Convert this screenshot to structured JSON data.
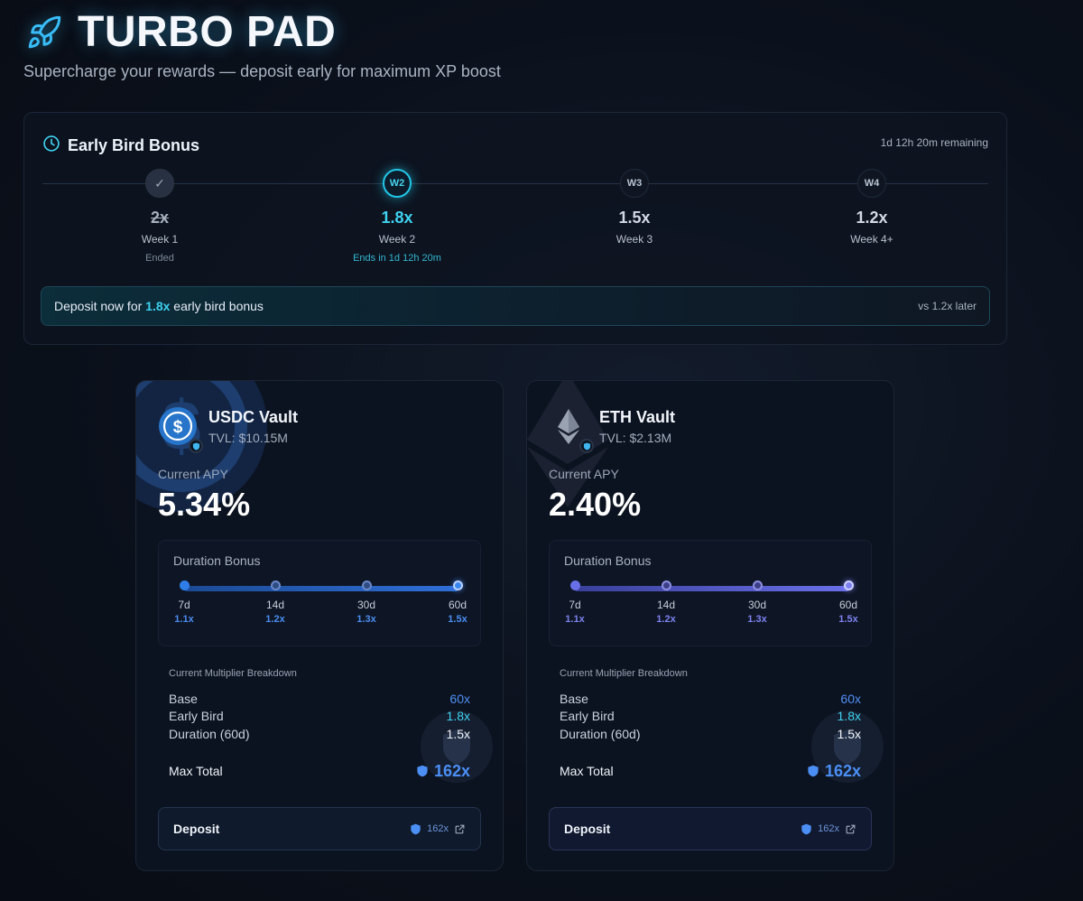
{
  "header": {
    "title": "TURBO PAD",
    "subtitle": "Supercharge your rewards — deposit early for maximum XP boost"
  },
  "early_bird": {
    "title": "Early Bird Bonus",
    "remaining": "1d 12h 20m remaining",
    "weeks": [
      {
        "node": "✓",
        "multiplier": "2x",
        "label": "Week 1",
        "note": "Ended",
        "state": "done"
      },
      {
        "node": "W2",
        "multiplier": "1.8x",
        "label": "Week 2",
        "note": "Ends in 1d 12h 20m",
        "state": "active"
      },
      {
        "node": "W3",
        "multiplier": "1.5x",
        "label": "Week 3",
        "note": "",
        "state": "future"
      },
      {
        "node": "W4",
        "multiplier": "1.2x",
        "label": "Week 4+",
        "note": "",
        "state": "future"
      }
    ],
    "banner": {
      "prefix": "Deposit now for ",
      "highlight": "1.8x",
      "suffix": " early bird bonus",
      "compare": "vs 1.2x later"
    }
  },
  "vaults": [
    {
      "name": "USDC Vault",
      "tvl": "TVL: $10.15M",
      "apy_label": "Current APY",
      "apy": "5.34%",
      "duration_title": "Duration Bonus",
      "durations": [
        {
          "day": "7d",
          "mult": "1.1x"
        },
        {
          "day": "14d",
          "mult": "1.2x"
        },
        {
          "day": "30d",
          "mult": "1.3x"
        },
        {
          "day": "60d",
          "mult": "1.5x"
        }
      ],
      "breakdown_title": "Current Multiplier Breakdown",
      "breakdown": [
        {
          "label": "Base",
          "value": "60x"
        },
        {
          "label": "Early Bird",
          "value": "1.8x"
        },
        {
          "label": "Duration (60d)",
          "value": "1.5x"
        }
      ],
      "max_label": "Max Total",
      "max_value": "162x",
      "deposit_label": "Deposit",
      "deposit_mult": "162x",
      "accent": "#2f7ee8"
    },
    {
      "name": "ETH Vault",
      "tvl": "TVL: $2.13M",
      "apy_label": "Current APY",
      "apy": "2.40%",
      "duration_title": "Duration Bonus",
      "durations": [
        {
          "day": "7d",
          "mult": "1.1x"
        },
        {
          "day": "14d",
          "mult": "1.2x"
        },
        {
          "day": "30d",
          "mult": "1.3x"
        },
        {
          "day": "60d",
          "mult": "1.5x"
        }
      ],
      "breakdown_title": "Current Multiplier Breakdown",
      "breakdown": [
        {
          "label": "Base",
          "value": "60x"
        },
        {
          "label": "Early Bird",
          "value": "1.8x"
        },
        {
          "label": "Duration (60d)",
          "value": "1.5x"
        }
      ],
      "max_label": "Max Total",
      "max_value": "162x",
      "deposit_label": "Deposit",
      "deposit_mult": "162x",
      "accent": "#6a6fe8"
    }
  ],
  "icons": [
    "rocket-icon",
    "clock-icon",
    "check-icon",
    "usdc-icon",
    "eth-icon",
    "shield-badge-icon",
    "external-link-icon"
  ],
  "colors": {
    "cyan": "#3fd2ef",
    "blue": "#4b8ff5",
    "purple": "#7d82ee",
    "bg": "#0b111c"
  }
}
